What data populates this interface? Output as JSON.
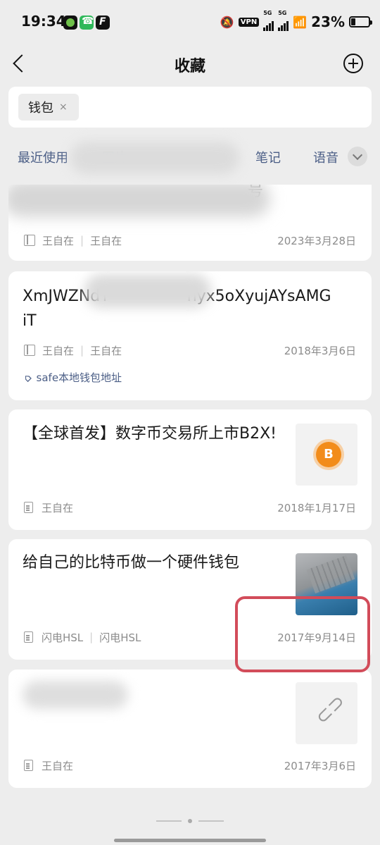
{
  "status": {
    "time": "19:34",
    "vpn": "VPN",
    "sim1": "5G",
    "sim2": "5G",
    "battery": "23%"
  },
  "nav": {
    "title": "收藏"
  },
  "search": {
    "chip": "钱包",
    "chip_close": "×"
  },
  "tabs": {
    "recent": "最近使用",
    "partial": "图片",
    "notes": "笔记",
    "voice": "语音"
  },
  "cards": [
    {
      "title_tail": "号",
      "source": "王自在",
      "author": "王自在",
      "date": "2023年3月28日"
    },
    {
      "title_line1_start": "XmJWZNdY",
      "title_line1_end": "hyx5oXyujAYsAMG",
      "title_line2": "iT",
      "source": "王自在",
      "author": "王自在",
      "date": "2018年3月6日",
      "tag": "safe本地钱包地址"
    },
    {
      "title": "【全球首发】数字币交易所上市B2X!",
      "source": "王自在",
      "date": "2018年1月17日",
      "thumb_icon": "B"
    },
    {
      "title": "给自己的比特币做一个硬件钱包",
      "source": "闪电HSL",
      "author": "闪电HSL",
      "date": "2017年9月14日"
    },
    {
      "source": "王自在",
      "date": "2017年3月6日",
      "thumb_icon": "link-icon"
    }
  ],
  "colors": {
    "background": "#ededed",
    "tab_text": "#4b5e86",
    "annotation_box": "#d24c5a",
    "meta_text": "#8c8c8c"
  }
}
